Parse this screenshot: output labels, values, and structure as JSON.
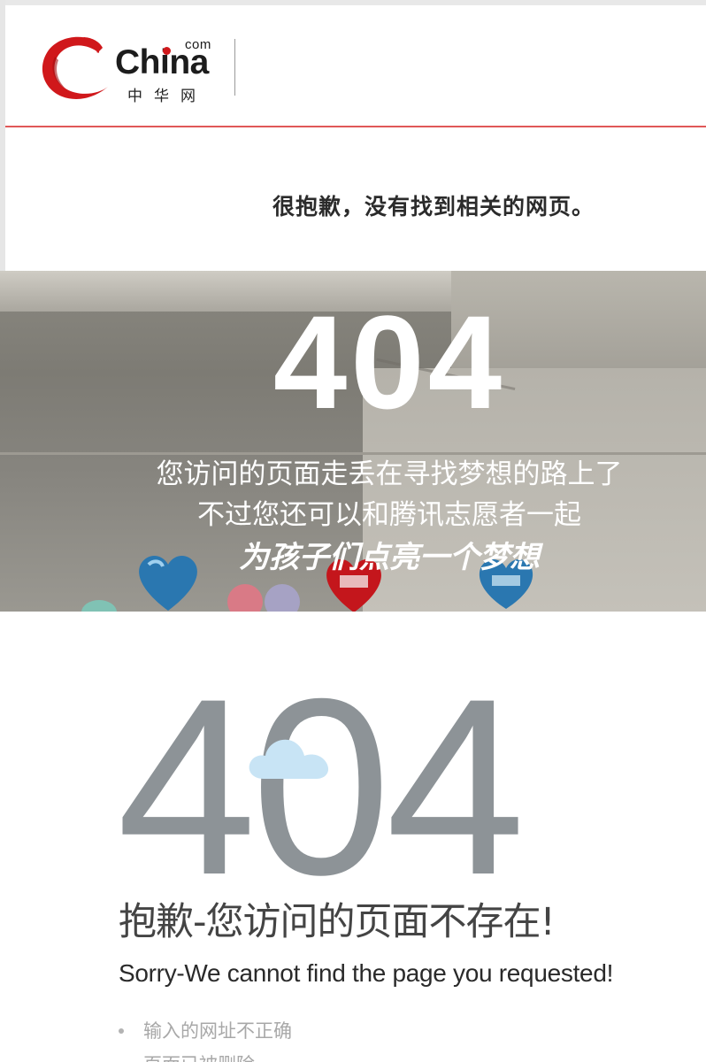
{
  "header": {
    "logo_com": "com",
    "logo_china": "China",
    "logo_cn": "中华网",
    "accent_color": "#e05858",
    "brand_red": "#d0181b"
  },
  "notice": {
    "sorry_cn": "很抱歉，没有找到相关的网页。"
  },
  "hero": {
    "code": "404",
    "line1": "您访问的页面走丢在寻找梦想的路上了",
    "line2": "不过您还可以和腾讯志愿者一起",
    "line3": "为孩子们点亮一个梦想"
  },
  "error": {
    "code": "404",
    "title_cn": "抱歉-您访问的页面不存在!",
    "title_en": "Sorry-We cannot find the page you requested!",
    "reasons": [
      "输入的网址不正确",
      "页面已被删除"
    ]
  }
}
